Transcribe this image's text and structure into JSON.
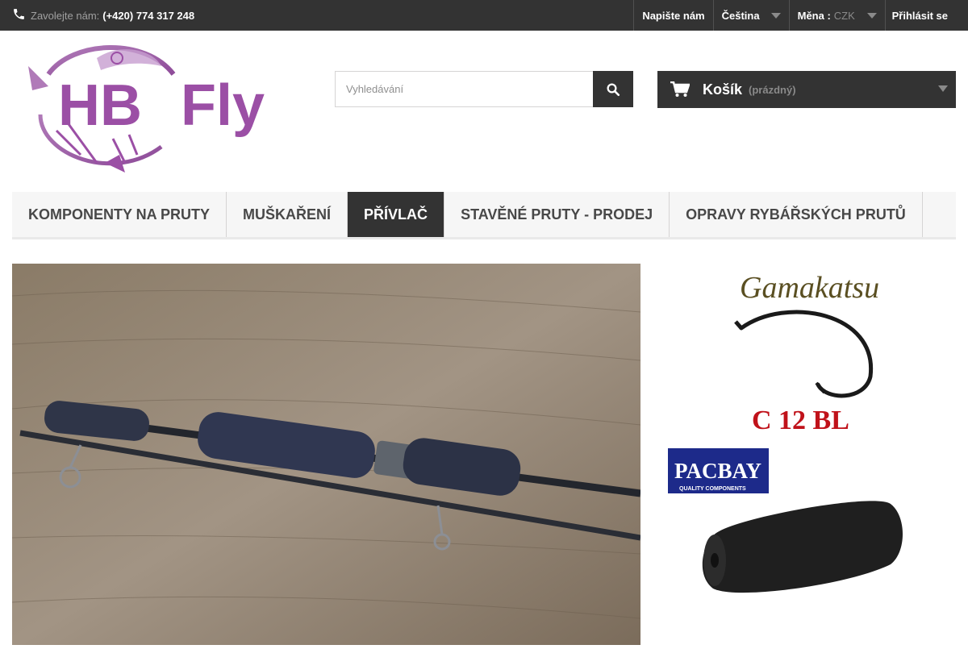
{
  "topbar": {
    "phone_label": "Zavolejte nám:",
    "phone_number": "(+420) 774 317 248",
    "contact": "Napište nám",
    "language": "Čeština",
    "currency_label": "Měna :",
    "currency_value": "CZK",
    "login": "Přihlásit se"
  },
  "logo": {
    "text_a": "HB",
    "text_b": "Fly"
  },
  "search": {
    "placeholder": "Vyhledávání"
  },
  "cart": {
    "title": "Košík",
    "status": "(prázdný)"
  },
  "menu": {
    "items": [
      {
        "label": "Komponenty na pruty",
        "active": false
      },
      {
        "label": "Muškaření",
        "active": false
      },
      {
        "label": "Přívlač",
        "active": true
      },
      {
        "label": "Stavěné pruty - prodej",
        "active": false
      },
      {
        "label": "Opravy rybářských prutů",
        "active": false
      }
    ]
  },
  "banners": {
    "top_brand": "Gamakatsu",
    "top_caption": "C 12 BL",
    "bottom_brand": "PACBAY",
    "bottom_sub": "QUALITY COMPONENTS"
  },
  "colors": {
    "dark": "#333333",
    "accent": "#9b4fa5",
    "menu_bg": "#f6f6f6"
  }
}
